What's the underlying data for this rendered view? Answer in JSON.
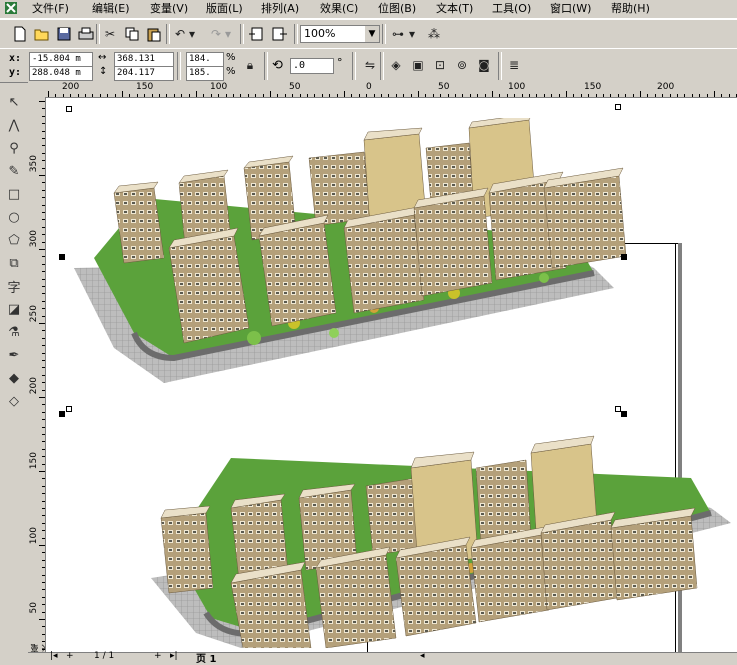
{
  "menubar": {
    "items": [
      "文件(F)",
      "编辑(E)",
      "变量(V)",
      "版面(L)",
      "排列(A)",
      "效果(C)",
      "位图(B)",
      "文本(T)",
      "工具(O)",
      "窗口(W)",
      "帮助(H)"
    ]
  },
  "standard_toolbar": {
    "zoom_value": "100%"
  },
  "property_bar": {
    "x_label": "x:",
    "y_label": "y:",
    "x_value": "-15.804 m",
    "y_value": "288.048 m",
    "width_value": "368.131",
    "height_value": "204.117",
    "scale_x": "184.",
    "scale_y": "185.",
    "percent": "%",
    "rotation_value": ".0",
    "degree": "°"
  },
  "ruler_h": {
    "labels": [
      "200",
      "150",
      "100",
      "50",
      "0",
      "50",
      "100",
      "150",
      "200"
    ]
  },
  "ruler_v": {
    "labels": [
      "350",
      "300",
      "250",
      "200",
      "150",
      "100",
      "50"
    ],
    "unit": "毫米"
  },
  "statusbar": {
    "page_nav": "1 / 1",
    "page_tab": "页 1"
  }
}
